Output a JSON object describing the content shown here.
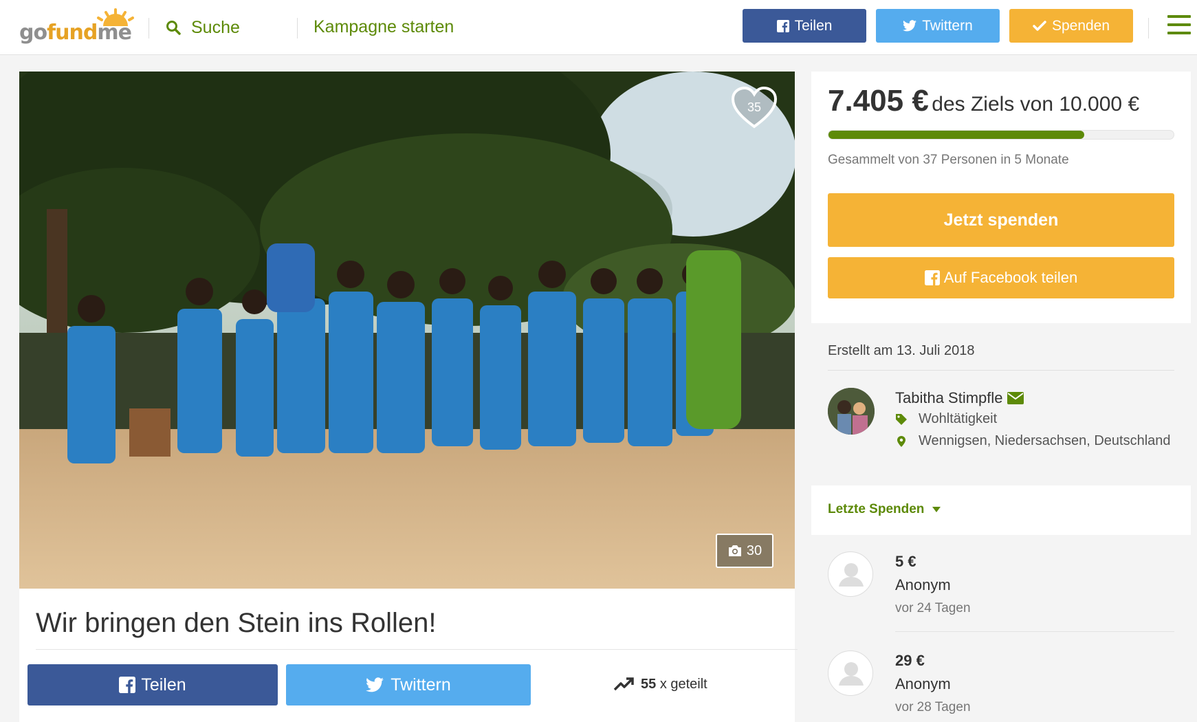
{
  "header": {
    "logo_go": "go",
    "logo_fund": "fund",
    "logo_me": "me",
    "search_label": "Suche",
    "start_campaign": "Kampagne starten",
    "btn_share": "Teilen",
    "btn_tweet": "Twittern",
    "btn_donate": "Spenden"
  },
  "campaign": {
    "hearts": "35",
    "photos": "30",
    "title": "Wir bringen den Stein ins Rollen!",
    "share_fb": "Teilen",
    "share_tw": "Twittern",
    "shares_count": "55",
    "shares_suffix": "x geteilt"
  },
  "donate": {
    "raised": "7.405 €",
    "goal_text": "des Ziels von 10.000 €",
    "progress_fraction": 0.7405,
    "raised_by": "Gesammelt von 37 Personen in 5 Monate",
    "donate_now": "Jetzt spenden",
    "fb_share": "Auf Facebook teilen"
  },
  "organizer": {
    "created": "Erstellt am 13. Juli 2018",
    "name": "Tabitha Stimpfle",
    "category": "Wohltätigkeit",
    "location": "Wennigsen, Niedersachsen, Deutschland"
  },
  "recent": {
    "title": "Letzte Spenden",
    "donations": [
      {
        "amount": "5 €",
        "name": "Anonym",
        "time": "vor 24 Tagen"
      },
      {
        "amount": "29 €",
        "name": "Anonym",
        "time": "vor 28 Tagen"
      }
    ]
  },
  "colors": {
    "green": "#5d8a08",
    "orange": "#f5b336",
    "facebook": "#3b5998",
    "twitter": "#55acee"
  }
}
